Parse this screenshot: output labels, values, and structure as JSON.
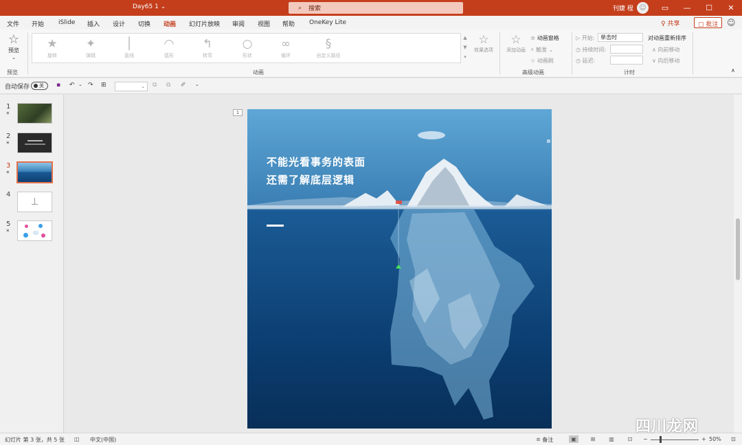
{
  "titlebar": {
    "doc_title": "Day65 1",
    "dropdown_glyph": "⌄",
    "search_icon": "⌕",
    "search_placeholder": "搜索",
    "user": "刊婕 程",
    "avatar_glyph": "☺",
    "ribbon_opts_glyph": "▭",
    "minimize_glyph": "—",
    "maximize_glyph": "☐",
    "close_glyph": "✕"
  },
  "menu": {
    "items": [
      "文件",
      "开始",
      "iSlide",
      "插入",
      "设计",
      "切换",
      "动画",
      "幻灯片放映",
      "审阅",
      "视图",
      "帮助",
      "OneKey Lite"
    ],
    "active_index": 6,
    "share": "♀ 共享",
    "comment": "▢ 批注",
    "feedback_glyph": "☺"
  },
  "ribbon": {
    "preview": {
      "icon": "☆",
      "label": "预览",
      "arrow": "⌄",
      "group": "预览"
    },
    "animations": {
      "items": [
        {
          "icon": "★",
          "label": "旋转"
        },
        {
          "icon": "✦",
          "label": "弹跳"
        },
        {
          "icon": "│",
          "label": "直线"
        },
        {
          "icon": "◠",
          "label": "弧形"
        },
        {
          "icon": "↰",
          "label": "转弯"
        },
        {
          "icon": "○",
          "label": "形状"
        },
        {
          "icon": "∞",
          "label": "循环"
        },
        {
          "icon": "§",
          "label": "自定义路径"
        }
      ],
      "group": "动画",
      "effect_options": {
        "icon": "☆",
        "label": "效果选项"
      },
      "gallery_arrows": [
        "▲",
        "▼",
        "▾"
      ]
    },
    "advanced": {
      "add_icon": "☆",
      "add": "添加动画",
      "pane": "☆ 动画窗格",
      "trigger": "⚡ 触发 ⌄",
      "painter": "☆ 动画刷",
      "group": "高级动画"
    },
    "timing": {
      "start_label": "▷ 开始:",
      "start_value": "单击时",
      "duration_label": "◷ 持续时间:",
      "delay_label": "◷ 延迟:",
      "reorder": "对动画重新排序",
      "earlier": "∧ 向前移动",
      "later": "∨ 向后移动",
      "group": "计时"
    },
    "collapse_glyph": "∧"
  },
  "qat": {
    "autosave": "自动保存",
    "toggle": "关",
    "save_icon": "▪",
    "undo_icon": "↶",
    "undo_arrow": "⌄",
    "redo_icon": "↷",
    "present_icon": "⊞",
    "font_arrow": "⌄",
    "icon_a": "⧉",
    "icon_b": "⧉",
    "icon_c": "✐",
    "more": "⌄"
  },
  "slides_panel": {
    "items": [
      {
        "num": "1",
        "star": "*"
      },
      {
        "num": "2",
        "star": "*"
      },
      {
        "num": "3",
        "star": "*"
      },
      {
        "num": "4",
        "star": ""
      },
      {
        "num": "5",
        "star": "*"
      }
    ],
    "active_index": 2
  },
  "slide": {
    "number": "1",
    "line1": "不能光看事务的表面",
    "line2": "还需了解底层逻辑"
  },
  "status": {
    "slide_info": "幻灯片 第 3 张，共 5 张",
    "accessibility_icon": "◫",
    "language": "中文(中国)",
    "notes": "≘ 备注",
    "view_icons": [
      "▣",
      "⊞",
      "▥",
      "⊡"
    ],
    "zoom_minus": "−",
    "zoom_plus": "+",
    "zoom": "50%",
    "fit_icon": "⊡"
  },
  "watermark": "四川龙网",
  "colors": {
    "accent": "#c43e1c",
    "ribbon_bg": "#f7f7f7"
  }
}
